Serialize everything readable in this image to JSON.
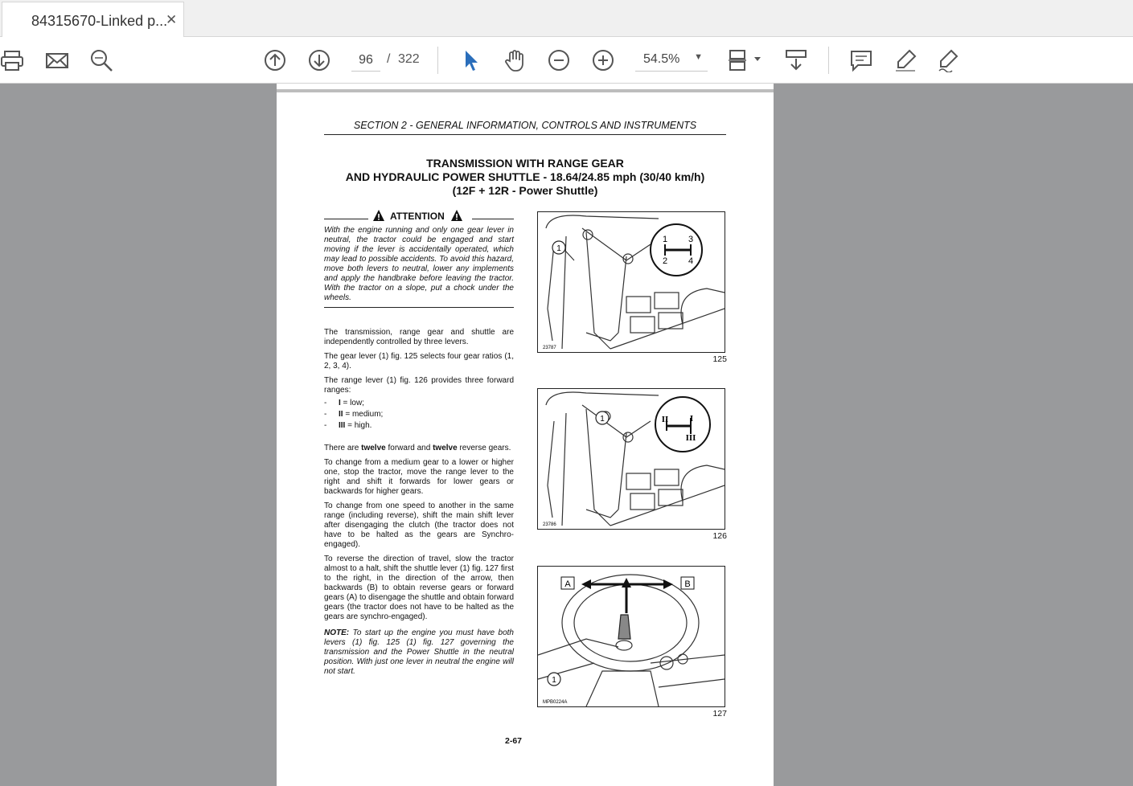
{
  "tab": {
    "title": "84315670-Linked p...",
    "close": "✕"
  },
  "toolbar": {
    "page_current": "96",
    "page_separator": "/",
    "page_total": "322",
    "zoom": "54.5%",
    "zoom_caret": "▼",
    "icons": [
      "print-icon",
      "email-icon",
      "find-icon",
      "page-up-icon",
      "page-down-icon",
      "select-cursor-icon",
      "hand-icon",
      "zoom-out-icon",
      "zoom-in-icon",
      "fit-page-icon",
      "scroll-mode-icon",
      "comment-icon",
      "highlight-icon",
      "sign-icon"
    ],
    "accent_color": "#2a6ebb"
  },
  "document": {
    "section_header": "SECTION 2 - GENERAL INFORMATION, CONTROLS AND INSTRUMENTS",
    "title_line1": "TRANSMISSION WITH RANGE GEAR",
    "title_line2": "AND HYDRAULIC POWER SHUTTLE - 18.64/24.85 mph (30/40 km/h)",
    "title_line3": "(12F + 12R - Power Shuttle)",
    "attention_label": "ATTENTION",
    "attention_text": "With the engine running and only one gear lever in neutral, the tractor could be engaged and start moving if the lever is accidentally operated, which may lead to possible accidents. To avoid this hazard, move both levers to neutral, lower any implements and apply the handbrake before leaving the tractor. With the tractor on a slope, put a chock under the wheels.",
    "p1": "The transmission, range gear and shuttle are independently controlled by three levers.",
    "p2": "The gear lever (1) fig. 125 selects four gear ratios (1, 2, 3, 4).",
    "p3": "The range lever (1) fig. 126 provides three forward ranges:",
    "list": [
      {
        "dash": "-",
        "roman": "I",
        "text": " = low;"
      },
      {
        "dash": "-",
        "roman": "II",
        "text": " = medium;"
      },
      {
        "dash": "-",
        "roman": "III",
        "text": " = high."
      }
    ],
    "p4_a": "There are ",
    "p4_b": "twelve",
    "p4_c": " forward and ",
    "p4_d": "twelve",
    "p4_e": " reverse gears.",
    "p5": "To change from a medium gear to a lower or higher one, stop the tractor, move the range lever to the right and shift it forwards for lower gears or backwards for higher gears.",
    "p6": "To change from one speed to another in the same range (including reverse), shift the main shift lever after disengaging the clutch (the tractor does not have to be halted as the gears are Synchro-engaged).",
    "p7": "To reverse the direction of travel, slow the tractor almost to a halt, shift the shuttle lever (1) fig. 127 first to the right, in the direction of the arrow, then backwards (B) to obtain reverse gears or forward gears (A) to disengage the shuttle and obtain forward gears (the tractor does not have to be halted as the gears are synchro-engaged).",
    "note_label": "NOTE:",
    "note_text": " To start up the engine you must have both levers (1) fig. 125 (1) fig. 127 governing the transmission and the Power Shuttle in the neutral position. With just one lever in neutral the engine will not start.",
    "figures": [
      {
        "number": "125",
        "code": "23787",
        "callout": "1",
        "gears": [
          "1",
          "3",
          "2",
          "4"
        ]
      },
      {
        "number": "126",
        "code": "23786",
        "callout": "1",
        "ranges": [
          "II",
          "I",
          "III"
        ]
      },
      {
        "number": "127",
        "code": "MPB0224A",
        "callout": "1",
        "arrows": [
          "A",
          "B"
        ]
      }
    ],
    "page_number": "2-67"
  }
}
